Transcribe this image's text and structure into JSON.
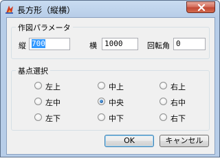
{
  "window": {
    "title": "長方形（縦横）"
  },
  "params": {
    "title": "作図パラメータ",
    "fields": [
      {
        "label": "縦",
        "value": "700"
      },
      {
        "label": "横",
        "value": "1000"
      },
      {
        "label": "回転角",
        "value": "0"
      }
    ]
  },
  "anchor": {
    "title": "基点選択",
    "options": [
      "左上",
      "中上",
      "右上",
      "左中",
      "中央",
      "右中",
      "左下",
      "中下",
      "右下"
    ],
    "selected": "中央"
  },
  "buttons": {
    "ok": "OK",
    "cancel": "キャンセル"
  },
  "colors": {
    "close_button": "#c9482f",
    "selection": "#3399ff",
    "radio_dot": "#1f5fa8"
  }
}
